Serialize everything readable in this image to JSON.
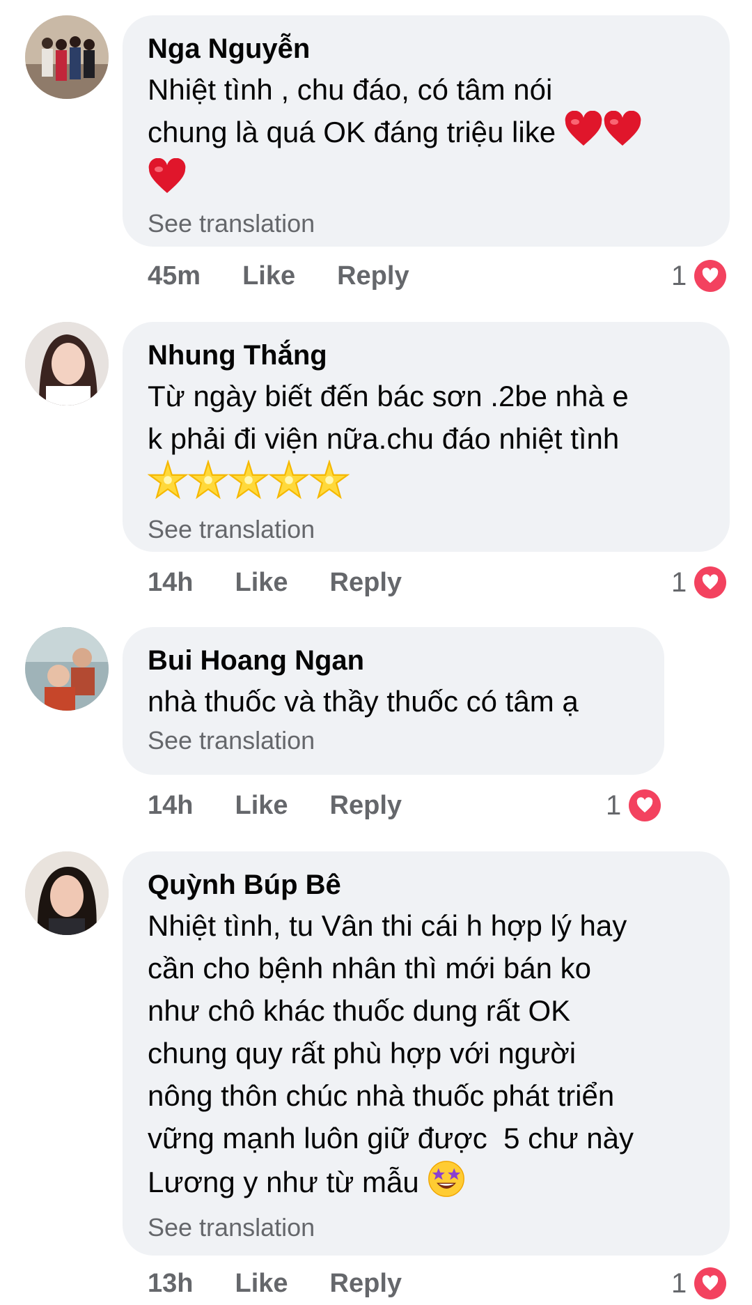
{
  "comments": [
    {
      "author": "Nga Nguyễn",
      "text": "Nhiệt tình , chu đáo, có tâm nói\nchung là quá OK đáng triệu like",
      "emoji": "red-heart ×3",
      "translate": "See translation",
      "time": "45m",
      "like": "Like",
      "reply": "Reply",
      "reactions": "1"
    },
    {
      "author": "Nhung Thắng",
      "text": "Từ ngày biết đến bác sơn .2be nhà e\nk phải đi viện nữa.chu đáo nhiệt tình",
      "emoji": "glowing-star ×5",
      "translate": "See translation",
      "time": "14h",
      "like": "Like",
      "reply": "Reply",
      "reactions": "1"
    },
    {
      "author": "Bui Hoang Ngan",
      "text": "nhà thuốc và thầy thuốc có tâm ạ",
      "translate": "See translation",
      "time": "14h",
      "like": "Like",
      "reply": "Reply",
      "reactions": "1"
    },
    {
      "author": "Quỳnh Búp Bê",
      "text": "Nhiệt tình, tu Vân thi cái h hợp lý hay\ncần cho bệnh nhân thì mới bán ko\nnhư chô khác thuốc dung rất OK\nchung quy rất phù hợp với người\nnông thôn chúc nhà thuốc phát triển\nvững mạnh luôn giữ được  5 chư này\nLương y như từ mẫu",
      "emoji": "star-struck",
      "translate": "See translation",
      "time": "13h",
      "like": "Like",
      "reply": "Reply",
      "reactions": "1"
    }
  ],
  "colors": {
    "bubble": "#f0f2f5",
    "meta": "#65676b",
    "heart": "#f3425f"
  }
}
